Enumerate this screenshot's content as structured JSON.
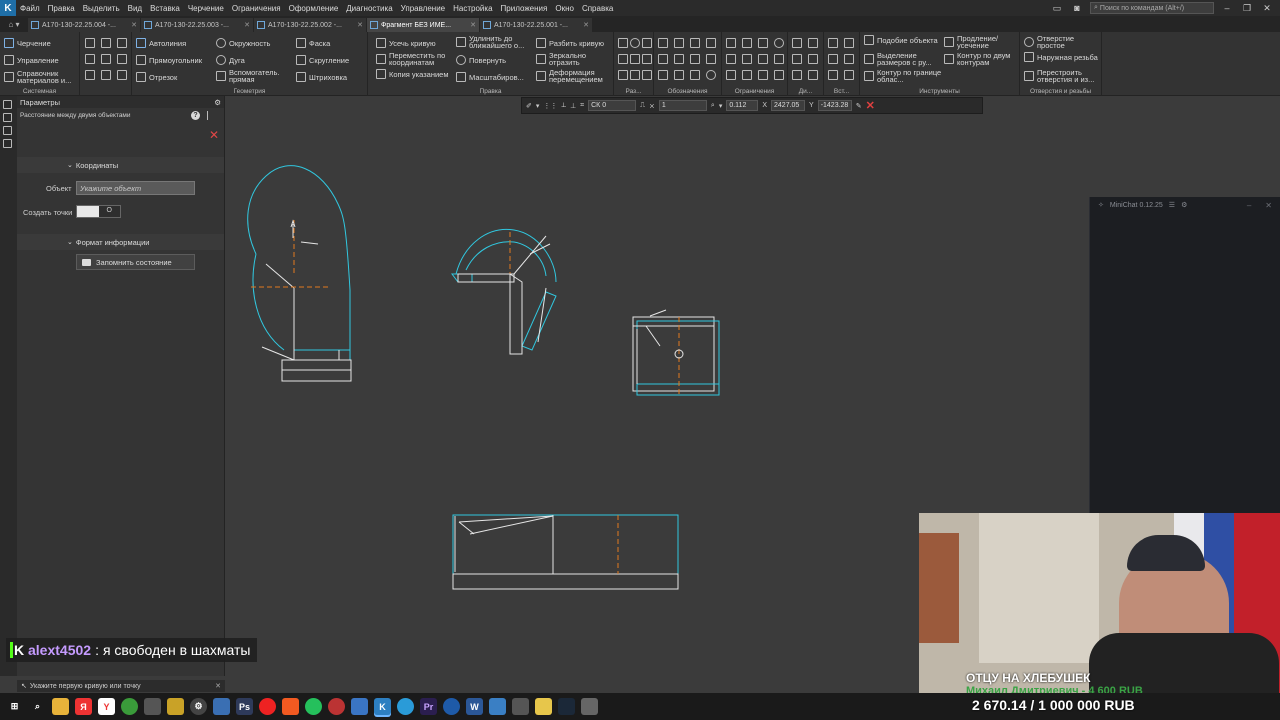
{
  "menu": {
    "items": [
      "Файл",
      "Правка",
      "Выделить",
      "Вид",
      "Вставка",
      "Черчение",
      "Ограничения",
      "Оформление",
      "Диагностика",
      "Управление",
      "Настройка",
      "Приложения",
      "Окно",
      "Справка"
    ],
    "command_search_placeholder": "Поиск по командам (Alt+/)"
  },
  "tabs": [
    {
      "label": "А170-130-22.25.004 -...",
      "active": false
    },
    {
      "label": "А170-130-22.25.003 -...",
      "active": false
    },
    {
      "label": "А170-130-22.25.002 -...",
      "active": false
    },
    {
      "label": "Фрагмент БЕЗ ИМЕ...",
      "active": true
    },
    {
      "label": "А170-130-22.25.001 -...",
      "active": false
    }
  ],
  "ribbon": {
    "system": {
      "label": "Системная",
      "items": [
        "Черчение",
        "Управление",
        "Справочник материалов и..."
      ]
    },
    "geometry": {
      "label": "Геометрия",
      "items": [
        "Автолиния",
        "Окружность",
        "Фаска",
        "Прямоугольник",
        "Дуга",
        "Скругление",
        "Отрезок",
        "Вспомогатель. прямая",
        "Штриховка"
      ]
    },
    "edit": {
      "label": "Правка",
      "items": [
        "Усечь кривую",
        "Удлинить до ближайшего о...",
        "Разбить кривую",
        "Переместить по координатам",
        "Повернуть",
        "Зеркально отразить",
        "Копия указанием",
        "Масштабиров...",
        "Деформация перемещением"
      ]
    },
    "small_groups": [
      "Раз...",
      "Обозначения",
      "Ограничения",
      "Ди...",
      "Вст..."
    ],
    "tools": {
      "label": "Инструменты",
      "items": [
        "Подобие объекта",
        "Продление/ усечение",
        "Выделение размеров с ру...",
        "Контур по двум контурам",
        "Контур по границе облас..."
      ]
    },
    "holes": {
      "label": "Отверстия и резьбы",
      "items": [
        "Отверстие простое",
        "Наружная резьба",
        "Перестроить отверстия и из..."
      ]
    }
  },
  "command_bar": {
    "cs_value": "СК 0",
    "layer_value": "1",
    "zoom_value": "0.112",
    "x_label": "X",
    "x_value": "2427.05",
    "y_label": "Y",
    "y_value": "-1423.28"
  },
  "panel": {
    "title": "Параметры",
    "subtitle": "Расстояние между двумя объектами",
    "section_coords": "Координаты",
    "object_label": "Объект",
    "object_placeholder": "Укажите объект",
    "create_points_label": "Создать точки",
    "toggle_off_glyph": "O",
    "section_format": "Формат информации",
    "remember_button": "Запомнить состояние"
  },
  "status": {
    "text": "Укажите первую кривую или точку"
  },
  "minichat": {
    "title": "MiniChat 0.12.25"
  },
  "chat_overlay": {
    "user": "alext4502",
    "separator": ":",
    "message": "я свободен в шахматы"
  },
  "webcam_overlay": {
    "line1": "ОТЦУ НА ХЛЕБУШЕК",
    "line2": "Михаил Дмитриевич - 4 600 RUB",
    "goal": "2 670.14 / 1 000 000 RUB"
  },
  "colors": {
    "accent": "#1f6fa8",
    "drawing_cyan": "#31c7df",
    "drawing_white": "#e6e6e6",
    "axis_orange": "#e07a1f",
    "chat_user": "#c59bff",
    "alert_red": "#e04646"
  },
  "taskbar": {
    "icons": [
      "windows-icon",
      "search-icon",
      "explorer-icon",
      "yandex-icon",
      "yandex-browser-icon",
      "chrome-icon",
      "tool-icon",
      "obs-icon",
      "settings-icon",
      "arrow-icon",
      "photoshop-icon",
      "opera-icon",
      "brave-icon",
      "whatsapp-icon",
      "app-icon",
      "cursor-icon",
      "kompas-icon",
      "telegram-icon",
      "premiere-icon",
      "edge-icon",
      "word-icon",
      "kompas2-icon",
      "app2-icon",
      "app3-icon",
      "steam-icon",
      "app4-icon"
    ]
  }
}
